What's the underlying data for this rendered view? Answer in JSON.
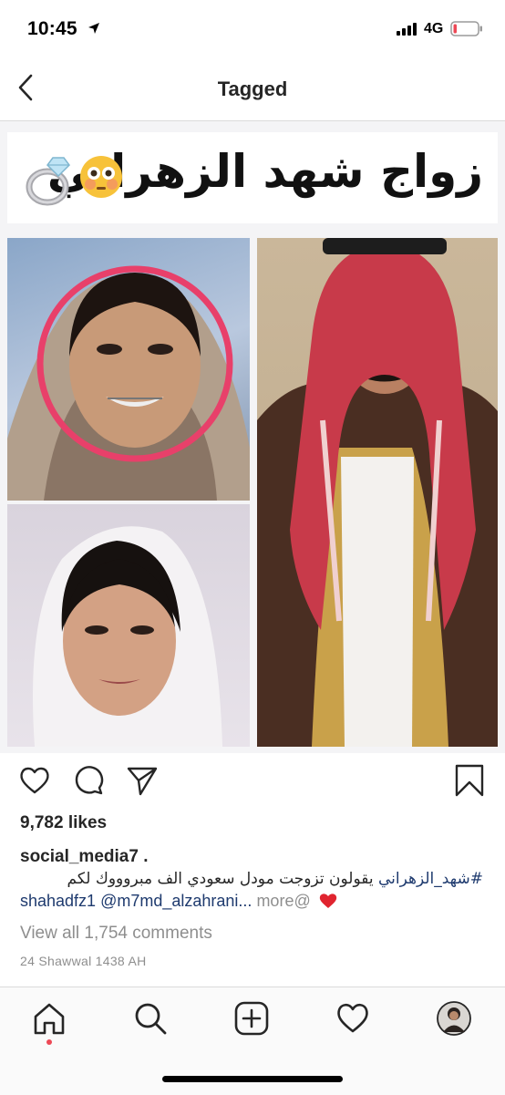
{
  "status_bar": {
    "time": "10:45",
    "network": "4G"
  },
  "nav": {
    "title": "Tagged"
  },
  "post": {
    "headline": "زواج شهد الزهراني",
    "likes": "9,782 likes",
    "username": "social_media7",
    "username_suffix": " .",
    "caption_hashtag": "#شهد_الزهراني",
    "caption_text": " يقولون تزوجت مودل سعودي الف مبروووك لكم",
    "caption_mention1": "shahadfz1",
    "caption_mention2": "@m7md_alzahrani...",
    "more_label": " more@",
    "comments_link": "View all 1,754 comments",
    "date": "24 Shawwal 1438 AH"
  },
  "colors": {
    "accent_red": "#ed4956",
    "link": "#1e3a6e",
    "muted": "#8e8e8e"
  },
  "icons": {
    "status": [
      "location-arrow-icon",
      "signal-bars-icon",
      "battery-icon"
    ],
    "nav": [
      "back-chevron-icon"
    ],
    "actions": [
      "heart-icon",
      "comment-icon",
      "share-icon",
      "bookmark-icon"
    ],
    "tabs": [
      "home-icon",
      "search-icon",
      "add-post-icon",
      "activity-heart-icon",
      "profile-avatar"
    ]
  }
}
